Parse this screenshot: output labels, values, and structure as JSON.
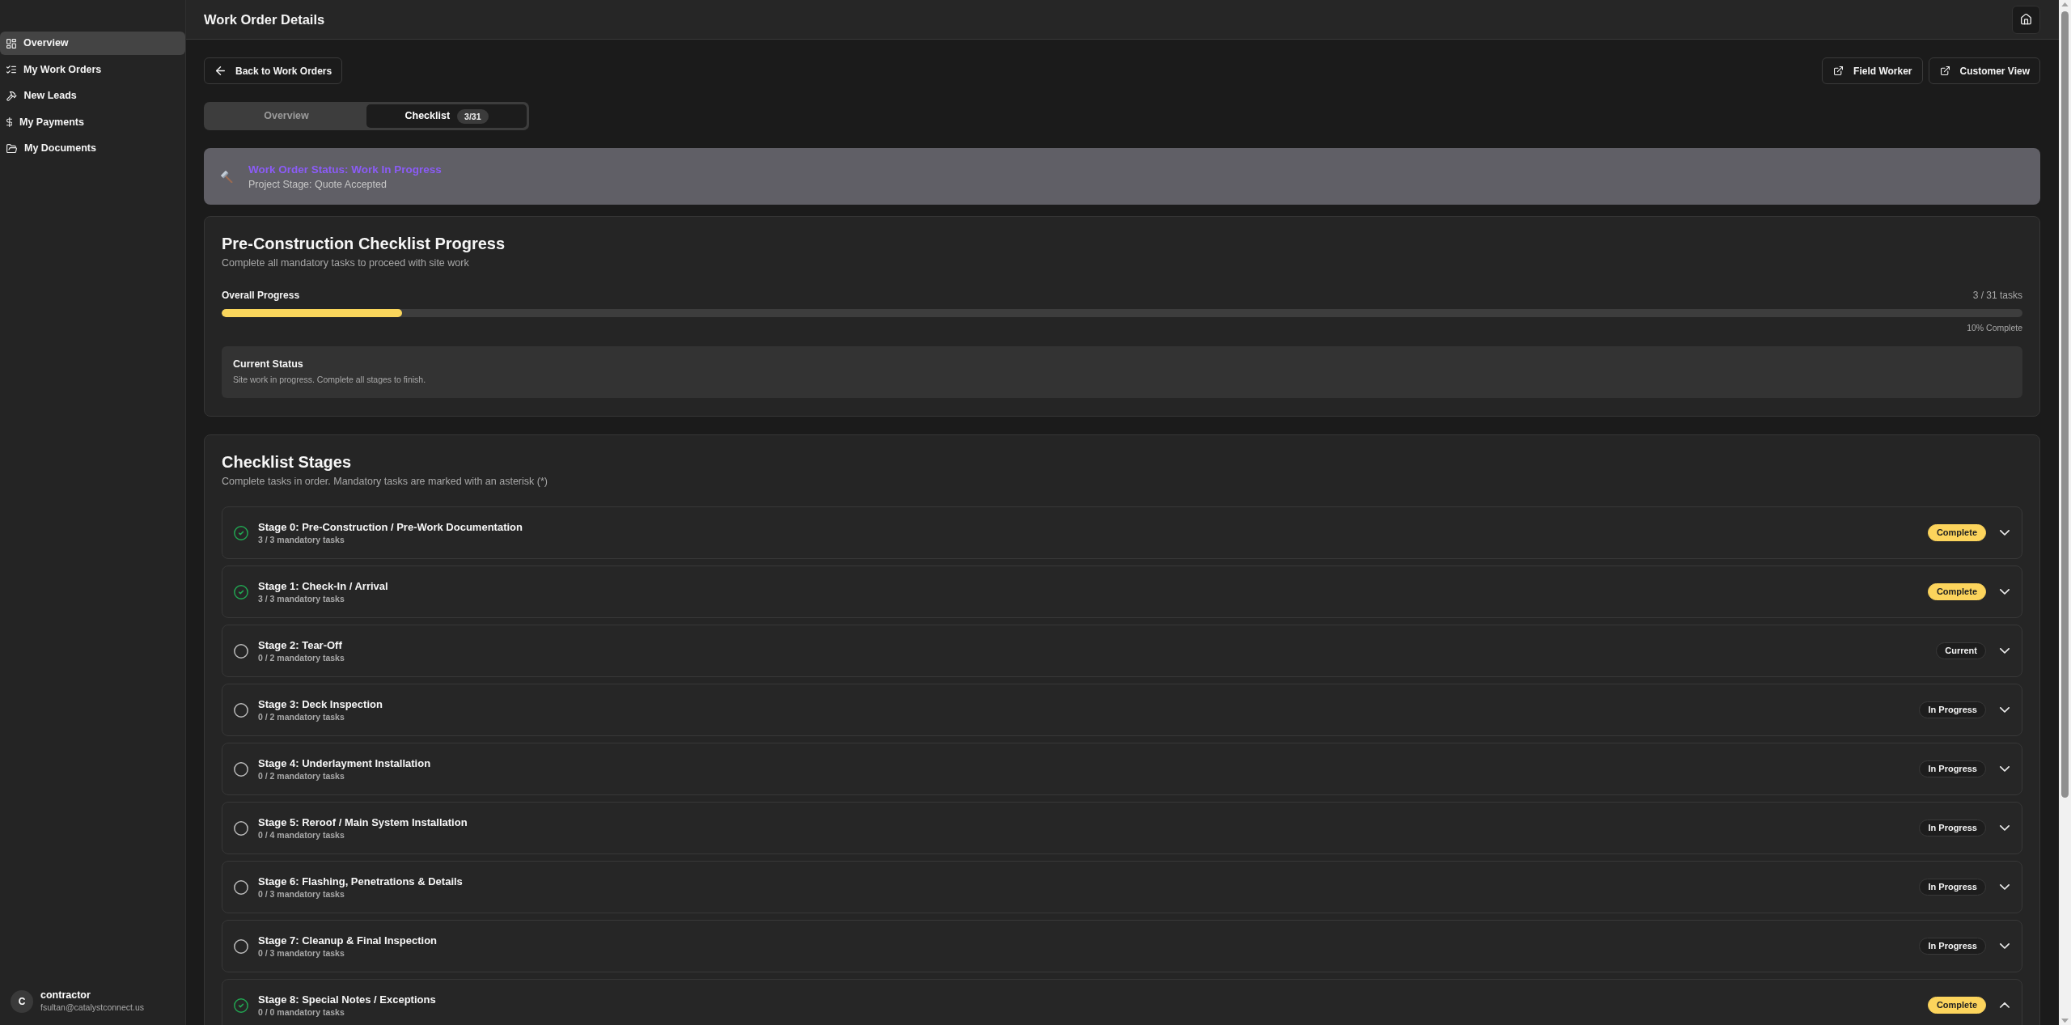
{
  "sidebar": {
    "items": [
      {
        "label": "Overview",
        "selected": true
      },
      {
        "label": "My Work Orders",
        "selected": false
      },
      {
        "label": "New Leads",
        "selected": false
      },
      {
        "label": "My Payments",
        "selected": false
      },
      {
        "label": "My Documents",
        "selected": false
      }
    ],
    "user": {
      "initial": "C",
      "name": "contractor",
      "email": "fsultan@catalystconnect.us"
    }
  },
  "header": {
    "title": "Work Order Details"
  },
  "toolbar": {
    "back_button": "Back to Work Orders",
    "view_buttons": [
      "Field Worker",
      "Customer View"
    ]
  },
  "tabs": [
    {
      "label": "Overview",
      "selected": false
    },
    {
      "label": "Checklist",
      "selected": true,
      "count": "3/31"
    }
  ],
  "status_banner": {
    "title": "Work Order Status: Work In Progress",
    "subtitle": "Project Stage: Quote Accepted"
  },
  "progress_card": {
    "title": "Pre-Construction Checklist Progress",
    "subtitle": "Complete all mandatory tasks to proceed with site work",
    "progress_label": "Overall Progress",
    "task_count": "3 / 31 tasks",
    "level": 0.1,
    "percent_label": "10% Complete",
    "current_status": {
      "title": "Current Status",
      "text": "Site work in progress. Complete all stages to finish."
    }
  },
  "stages_card": {
    "title": "Checklist Stages",
    "subtitle": "Complete tasks in order. Mandatory tasks are marked with an asterisk (*)",
    "stages": [
      {
        "title": "Stage 0: Pre-Construction / Pre-Work Documentation",
        "tasks": "3 / 3 mandatory tasks",
        "completed": true,
        "badge": {
          "label": "Complete",
          "kind": "complete"
        },
        "expanded": false
      },
      {
        "title": "Stage 1: Check-In / Arrival",
        "tasks": "3 / 3 mandatory tasks",
        "completed": true,
        "badge": {
          "label": "Complete",
          "kind": "complete"
        },
        "expanded": false
      },
      {
        "title": "Stage 2: Tear-Off",
        "tasks": "0 / 2 mandatory tasks",
        "completed": false,
        "badge": {
          "label": "Current",
          "kind": "current"
        },
        "expanded": false
      },
      {
        "title": "Stage 3: Deck Inspection",
        "tasks": "0 / 2 mandatory tasks",
        "completed": false,
        "badge": {
          "label": "In Progress",
          "kind": "in_progress"
        },
        "expanded": false
      },
      {
        "title": "Stage 4: Underlayment Installation",
        "tasks": "0 / 2 mandatory tasks",
        "completed": false,
        "badge": {
          "label": "In Progress",
          "kind": "in_progress"
        },
        "expanded": false
      },
      {
        "title": "Stage 5: Reroof / Main System Installation",
        "tasks": "0 / 4 mandatory tasks",
        "completed": false,
        "badge": {
          "label": "In Progress",
          "kind": "in_progress"
        },
        "expanded": false
      },
      {
        "title": "Stage 6: Flashing, Penetrations & Details",
        "tasks": "0 / 3 mandatory tasks",
        "completed": false,
        "badge": {
          "label": "In Progress",
          "kind": "in_progress"
        },
        "expanded": false
      },
      {
        "title": "Stage 7: Cleanup & Final Inspection",
        "tasks": "0 / 3 mandatory tasks",
        "completed": false,
        "badge": {
          "label": "In Progress",
          "kind": "in_progress"
        },
        "expanded": false
      },
      {
        "title": "Stage 8: Special Notes / Exceptions",
        "tasks": "0 / 0 mandatory tasks",
        "completed": true,
        "badge": {
          "label": "Complete",
          "kind": "complete"
        },
        "expanded": true
      }
    ]
  }
}
